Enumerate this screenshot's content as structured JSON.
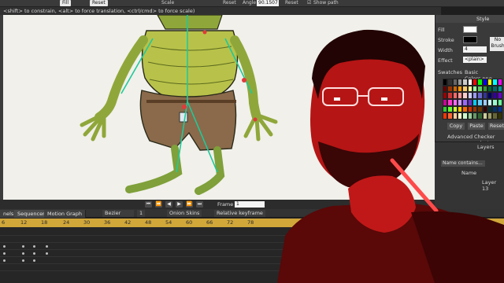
{
  "toolbar": {
    "item1": "Fill",
    "item2": "Reset",
    "scale_label": "Scale",
    "reset_label": "Reset",
    "angle_label": "Angle",
    "angle_value": "90.1507",
    "reset2_label": "Reset",
    "show_path": "Show path",
    "icon": "checkbox-icon"
  },
  "hint": "<shift> to constrain, <alt> to force translation, <ctrl/cmd> to force scale)",
  "playback": {
    "frame_label": "Frame",
    "frame_value": "1",
    "buttons": [
      "⏮",
      "⏪",
      "◀",
      "▶",
      "⏩",
      "⏭"
    ]
  },
  "timeline": {
    "tabs": [
      "nels",
      "Sequencer",
      "Motion Graph"
    ],
    "interp": "Bezier",
    "step": "1",
    "onion": "Onion Skins",
    "relative": "Relative keyframe",
    "ruler": [
      "6",
      "12",
      "18",
      "24",
      "30",
      "36",
      "42",
      "48",
      "54",
      "60",
      "66",
      "72",
      "78"
    ]
  },
  "style_panel": {
    "title": "Style",
    "fill_label": "Fill",
    "stroke_label": "Stroke",
    "width_label": "Width",
    "width_value": "4",
    "effect_label": "Effect",
    "effect_value": "<plain>",
    "no_brush": "No Brush",
    "swatches_label": "Swatches",
    "basic_colors": "Basic Colors.png",
    "copy": "Copy",
    "paste": "Paste",
    "reset": "Reset",
    "advanced": "Advanced",
    "checker": "Checker select",
    "accent": "#c8c8c8"
  },
  "layers": {
    "title": "Layers",
    "filter": "Name contains...",
    "name_col": "Name",
    "layer": "Layer 13"
  },
  "colors": {
    "canvas": "#f1f0ea",
    "ruler": "#d1a73a",
    "presenter_red": "#d11212"
  }
}
